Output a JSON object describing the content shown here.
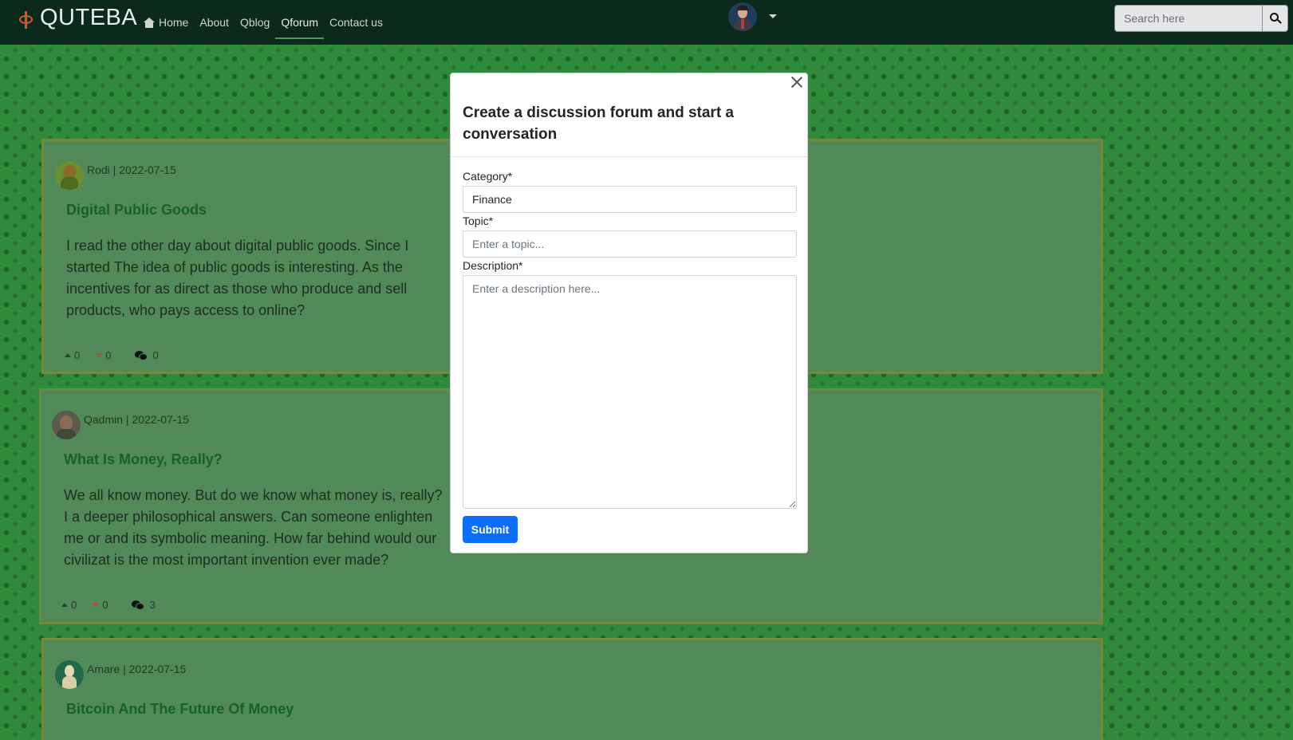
{
  "nav": {
    "brand": "QUTEBA",
    "links": [
      {
        "label": "Home"
      },
      {
        "label": "About"
      },
      {
        "label": "Qblog"
      },
      {
        "label": "Qforum"
      },
      {
        "label": "Contact us"
      }
    ],
    "active": "Qforum",
    "search_placeholder": "Search here"
  },
  "posts": [
    {
      "author": "Rodi",
      "date": "2022-07-15",
      "meta": "Rodi | 2022-07-15",
      "title": "Digital Public Goods",
      "body": "I read the other day about digital public goods. Since I started The idea of public goods is interesting. As the incentives for as direct as those who produce and sell products, who pays access to online?",
      "upvotes": "0",
      "downvotes": "0",
      "comments": "0"
    },
    {
      "author": "Qadmin",
      "date": "2022-07-15",
      "meta": "Qadmin | 2022-07-15",
      "title": "What Is Money, Really?",
      "body": "We all know money. But do we know what money is, really? I a deeper philosophical answers. Can someone enlighten me or and its symbolic meaning. How far behind would our civilizat is the most important invention ever made?",
      "upvotes": "0",
      "downvotes": "0",
      "comments": "3"
    },
    {
      "author": "Amare",
      "date": "2022-07-15",
      "meta": "Amare | 2022-07-15",
      "title": "Bitcoin And The Future Of Money"
    }
  ],
  "modal": {
    "title": "Create a discussion forum and start a conversation",
    "category_label": "Category*",
    "category_value": "Finance",
    "topic_label": "Topic*",
    "topic_placeholder": "Enter a topic...",
    "description_label": "Description*",
    "description_placeholder": "Enter a description here...",
    "submit_label": "Submit"
  },
  "colors": {
    "navbar": "#0b2a1c",
    "background": "#2f8a3c",
    "post_card": "#518a58",
    "title_green": "#16612c",
    "primary_button": "#0d6efd",
    "brand_accent": "#e0522a"
  }
}
